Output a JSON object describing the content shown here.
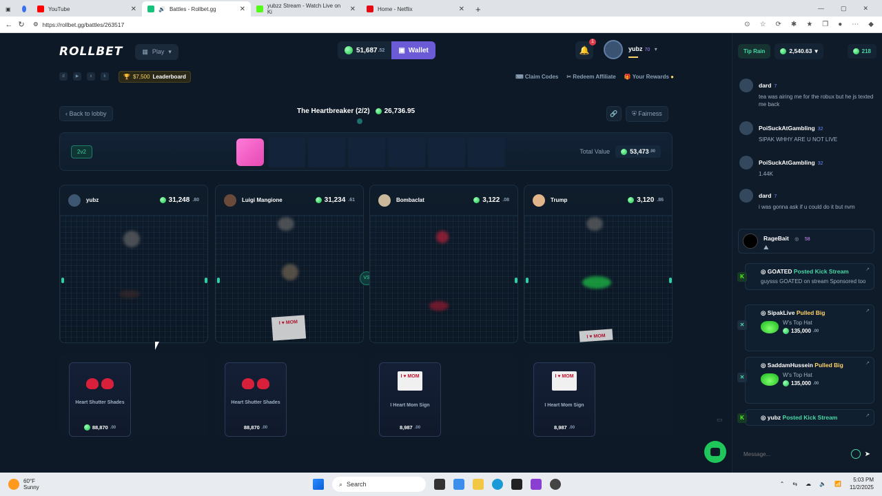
{
  "browser": {
    "tabs": [
      {
        "label": "YouTube",
        "color": "#ff0000"
      },
      {
        "label": "Battles - Rollbet.gg",
        "color": "#19c37d"
      },
      {
        "label": "yubzz Stream - Watch Live on Ki",
        "color": "#53fc18"
      },
      {
        "label": "Home - Netflix",
        "color": "#e50914"
      }
    ],
    "url": "https://rollbet.gg/battles/263517"
  },
  "header": {
    "logo": "ROLLBET",
    "play_label": "Play",
    "balance": "51,687",
    "balance_cents": ".52",
    "wallet_label": "Wallet",
    "notif_count": "1",
    "username": "yubz",
    "user_level": "70"
  },
  "subnav": {
    "leaderboard_amount": "$7,500",
    "leaderboard_label": "Leaderboard",
    "links": [
      "Claim Codes",
      "Redeem Affiliate",
      "Your Rewards"
    ]
  },
  "battle": {
    "back_label": "Back to lobby",
    "title": "The Heartbreaker (2/2)",
    "value": "26,736.95",
    "fairness_label": "Fairness",
    "mode": "2v2",
    "total_label": "Total Value",
    "total_value": "53,473",
    "total_cents": ".90",
    "vs_label": "VS"
  },
  "players": [
    {
      "name": "yubz",
      "value": "31,248",
      "cents": ".80"
    },
    {
      "name": "Luigi Mangione",
      "value": "31,234",
      "cents": ".61"
    },
    {
      "name": "Bombaclat",
      "value": "3,122",
      "cents": ".08"
    },
    {
      "name": "Trump",
      "value": "3,120",
      "cents": ".86"
    }
  ],
  "results": [
    {
      "name": "Heart Shutter Shades",
      "price": "88,870",
      "cents": ".00"
    },
    {
      "name": "Heart Shutter Shades",
      "price": "88,870",
      "cents": ".00"
    },
    {
      "name": "I Heart Mom Sign",
      "price": "8,987",
      "cents": ".00"
    },
    {
      "name": "I Heart Mom Sign",
      "price": "8,987",
      "cents": ".00"
    }
  ],
  "mom_sign_text": "I ♥ MOM",
  "chat": {
    "tip_rain": "Tip Rain",
    "rain_amount": "2,540.63",
    "online": "218",
    "messages": [
      {
        "name": "dard",
        "level": "7",
        "text": "tea was airing me for the robux but he js texted me back"
      },
      {
        "name": "PoiSuckAtGambling",
        "level": "32",
        "text": "SIPAK WHHY ARE U NOT LIVE"
      },
      {
        "name": "PoiSuckAtGambling",
        "level": "32",
        "text": "1.44K"
      },
      {
        "name": "dard",
        "level": "7",
        "text": "i was gonna ask if u could do it but nvm"
      }
    ],
    "rage": {
      "name": "RageBait",
      "level": "58"
    },
    "events": [
      {
        "name": "GOATED",
        "tag": "Posted Kick Stream",
        "text": "guysss GOATED on stream Sponsored too"
      },
      {
        "name": "SipakLive",
        "tag": "Pulled Big",
        "item": "W's Top Hat",
        "value": "135,000",
        "cents": ".00"
      },
      {
        "name": "SaddamHussein",
        "tag": "Pulled Big",
        "item": "W's Top Hat",
        "value": "135,000",
        "cents": ".00"
      },
      {
        "name": "yubz",
        "tag": "Posted Kick Stream"
      }
    ],
    "input_placeholder": "Message..."
  },
  "taskbar": {
    "temp": "60°F",
    "condition": "Sunny",
    "search": "Search",
    "time": "5:03 PM",
    "date": "11/2/2025"
  }
}
